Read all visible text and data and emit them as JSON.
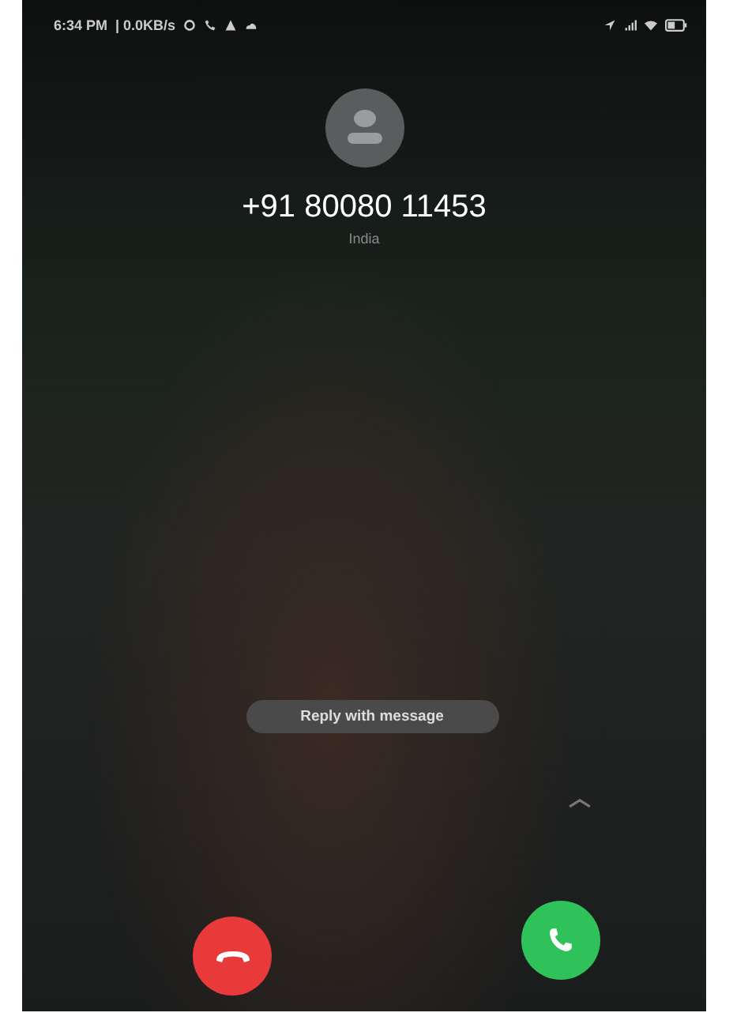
{
  "status_bar": {
    "time": "6:34 PM",
    "speed": "| 0.0KB/s"
  },
  "caller": {
    "number": "+91 80080 11453",
    "location": "India"
  },
  "reply_button": {
    "label": "Reply with message"
  }
}
